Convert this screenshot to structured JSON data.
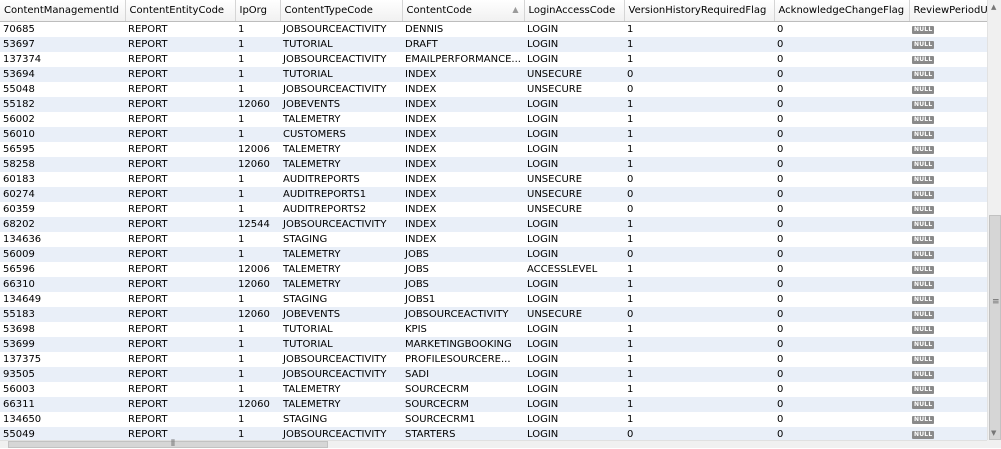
{
  "grid": {
    "columns": [
      {
        "label": "ContentManagementId"
      },
      {
        "label": "ContentEntityCode"
      },
      {
        "label": "IpOrg"
      },
      {
        "label": "ContentTypeCode"
      },
      {
        "label": "ContentCode",
        "sort": "ascending"
      },
      {
        "label": "LoginAccessCode"
      },
      {
        "label": "VersionHistoryRequiredFlag"
      },
      {
        "label": "AcknowledgeChangeFlag"
      },
      {
        "label": "ReviewPeriodU"
      }
    ],
    "null_label": "NULL",
    "rows": [
      [
        "70685",
        "REPORT",
        "1",
        "JOBSOURCEACTIVITY",
        "DENNIS",
        "LOGIN",
        "1",
        "0",
        null
      ],
      [
        "53697",
        "REPORT",
        "1",
        "TUTORIAL",
        "DRAFT",
        "LOGIN",
        "1",
        "0",
        null
      ],
      [
        "137374",
        "REPORT",
        "1",
        "JOBSOURCEACTIVITY",
        "EMAILPERFORMANCE...",
        "LOGIN",
        "1",
        "0",
        null
      ],
      [
        "53694",
        "REPORT",
        "1",
        "TUTORIAL",
        "INDEX",
        "UNSECURE",
        "0",
        "0",
        null
      ],
      [
        "55048",
        "REPORT",
        "1",
        "JOBSOURCEACTIVITY",
        "INDEX",
        "UNSECURE",
        "0",
        "0",
        null
      ],
      [
        "55182",
        "REPORT",
        "12060",
        "JOBEVENTS",
        "INDEX",
        "LOGIN",
        "1",
        "0",
        null
      ],
      [
        "56002",
        "REPORT",
        "1",
        "TALEMETRY",
        "INDEX",
        "LOGIN",
        "1",
        "0",
        null
      ],
      [
        "56010",
        "REPORT",
        "1",
        "CUSTOMERS",
        "INDEX",
        "LOGIN",
        "1",
        "0",
        null
      ],
      [
        "56595",
        "REPORT",
        "12006",
        "TALEMETRY",
        "INDEX",
        "LOGIN",
        "1",
        "0",
        null
      ],
      [
        "58258",
        "REPORT",
        "12060",
        "TALEMETRY",
        "INDEX",
        "LOGIN",
        "1",
        "0",
        null
      ],
      [
        "60183",
        "REPORT",
        "1",
        "AUDITREPORTS",
        "INDEX",
        "UNSECURE",
        "0",
        "0",
        null
      ],
      [
        "60274",
        "REPORT",
        "1",
        "AUDITREPORTS1",
        "INDEX",
        "UNSECURE",
        "0",
        "0",
        null
      ],
      [
        "60359",
        "REPORT",
        "1",
        "AUDITREPORTS2",
        "INDEX",
        "UNSECURE",
        "0",
        "0",
        null
      ],
      [
        "68202",
        "REPORT",
        "12544",
        "JOBSOURCEACTIVITY",
        "INDEX",
        "LOGIN",
        "1",
        "0",
        null
      ],
      [
        "134636",
        "REPORT",
        "1",
        "STAGING",
        "INDEX",
        "LOGIN",
        "1",
        "0",
        null
      ],
      [
        "56009",
        "REPORT",
        "1",
        "TALEMETRY",
        "JOBS",
        "LOGIN",
        "0",
        "0",
        null
      ],
      [
        "56596",
        "REPORT",
        "12006",
        "TALEMETRY",
        "JOBS",
        "ACCESSLEVEL",
        "1",
        "0",
        null
      ],
      [
        "66310",
        "REPORT",
        "12060",
        "TALEMETRY",
        "JOBS",
        "LOGIN",
        "1",
        "0",
        null
      ],
      [
        "134649",
        "REPORT",
        "1",
        "STAGING",
        "JOBS1",
        "LOGIN",
        "1",
        "0",
        null
      ],
      [
        "55183",
        "REPORT",
        "12060",
        "JOBEVENTS",
        "JOBSOURCEACTIVITY",
        "UNSECURE",
        "0",
        "0",
        null
      ],
      [
        "53698",
        "REPORT",
        "1",
        "TUTORIAL",
        "KPIS",
        "LOGIN",
        "1",
        "0",
        null
      ],
      [
        "53699",
        "REPORT",
        "1",
        "TUTORIAL",
        "MARKETINGBOOKING",
        "LOGIN",
        "1",
        "0",
        null
      ],
      [
        "137375",
        "REPORT",
        "1",
        "JOBSOURCEACTIVITY",
        "PROFILESOURCERE...",
        "LOGIN",
        "1",
        "0",
        null
      ],
      [
        "93505",
        "REPORT",
        "1",
        "JOBSOURCEACTIVITY",
        "SADI",
        "LOGIN",
        "1",
        "0",
        null
      ],
      [
        "56003",
        "REPORT",
        "1",
        "TALEMETRY",
        "SOURCECRM",
        "LOGIN",
        "1",
        "0",
        null
      ],
      [
        "66311",
        "REPORT",
        "12060",
        "TALEMETRY",
        "SOURCECRM",
        "LOGIN",
        "1",
        "0",
        null
      ],
      [
        "134650",
        "REPORT",
        "1",
        "STAGING",
        "SOURCECRM1",
        "LOGIN",
        "1",
        "0",
        null
      ],
      [
        "55049",
        "REPORT",
        "1",
        "JOBSOURCEACTIVITY",
        "STARTERS",
        "LOGIN",
        "0",
        "0",
        null
      ]
    ]
  }
}
